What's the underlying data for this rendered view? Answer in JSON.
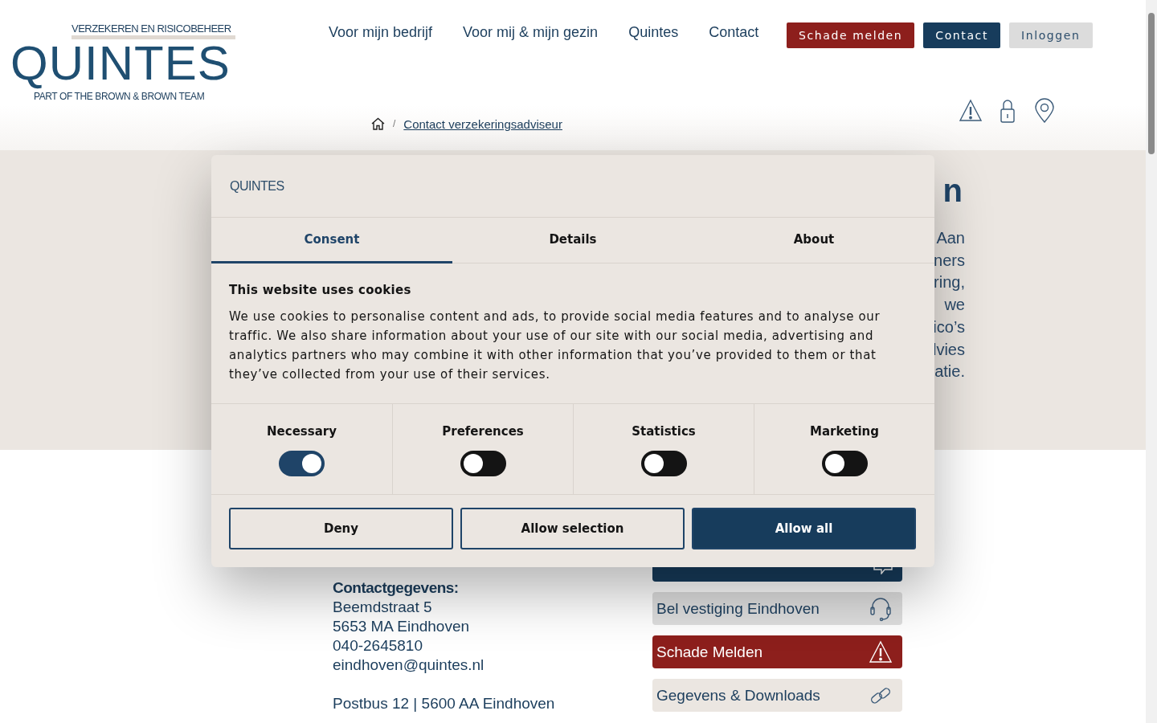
{
  "logo": {
    "tagline_top": "VERZEKEREN EN RISICOBEHEER",
    "name": "QUINTES",
    "tagline_bottom": "PART OF THE BROWN & BROWN TEAM"
  },
  "nav": [
    "Voor mijn bedrijf",
    "Voor mij & mijn gezin",
    "Quintes",
    "Contact"
  ],
  "header_buttons": [
    {
      "label": "Schade melden",
      "kind": "danger"
    },
    {
      "label": "Contact",
      "kind": "primary"
    },
    {
      "label": "Inloggen",
      "kind": "muted"
    }
  ],
  "breadcrumb": {
    "separator": "/",
    "items": [
      "Contact verzekeringsadviseur"
    ]
  },
  "hero": {
    "heading_fragment": "n",
    "text_fragments": [
      "Aan",
      "ners",
      "ring,",
      "we",
      "ico’s",
      "lvies",
      "atie."
    ]
  },
  "contact": {
    "heading": "Contactgegevens:",
    "lines": [
      "Beemdstraat 5",
      "5653 MA Eindhoven",
      "040-2645810",
      "eindhoven@quintes.nl"
    ],
    "postbus": "Postbus 12 | 5600 AA Eindhoven"
  },
  "actions": [
    {
      "kind": "chat"
    },
    {
      "kind": "phone",
      "label": "Bel vestiging Eindhoven"
    },
    {
      "kind": "alert",
      "label": "Schade Melden"
    },
    {
      "kind": "link",
      "label": "Gegevens & Downloads"
    }
  ],
  "cookie_dialog": {
    "logo": "QUINTES",
    "tabs": [
      {
        "label": "Consent",
        "selected": true
      },
      {
        "label": "Details",
        "selected": false
      },
      {
        "label": "About",
        "selected": false
      }
    ],
    "title": "This website uses cookies",
    "text": "We use cookies to personalise content and ads, to provide social media features and to analyse our traffic. We also share information about your use of our site with our social media, advertising and analytics partners who may combine it with other information that you’ve provided to them or that they’ve collected from your use of their services.",
    "categories": [
      {
        "label": "Necessary",
        "checked": true
      },
      {
        "label": "Preferences",
        "checked": false
      },
      {
        "label": "Statistics",
        "checked": false
      },
      {
        "label": "Marketing",
        "checked": false
      }
    ],
    "buttons": [
      {
        "label": "Deny",
        "kind": "outline"
      },
      {
        "label": "Allow selection",
        "kind": "outline"
      },
      {
        "label": "Allow all",
        "kind": "filled"
      }
    ]
  }
}
